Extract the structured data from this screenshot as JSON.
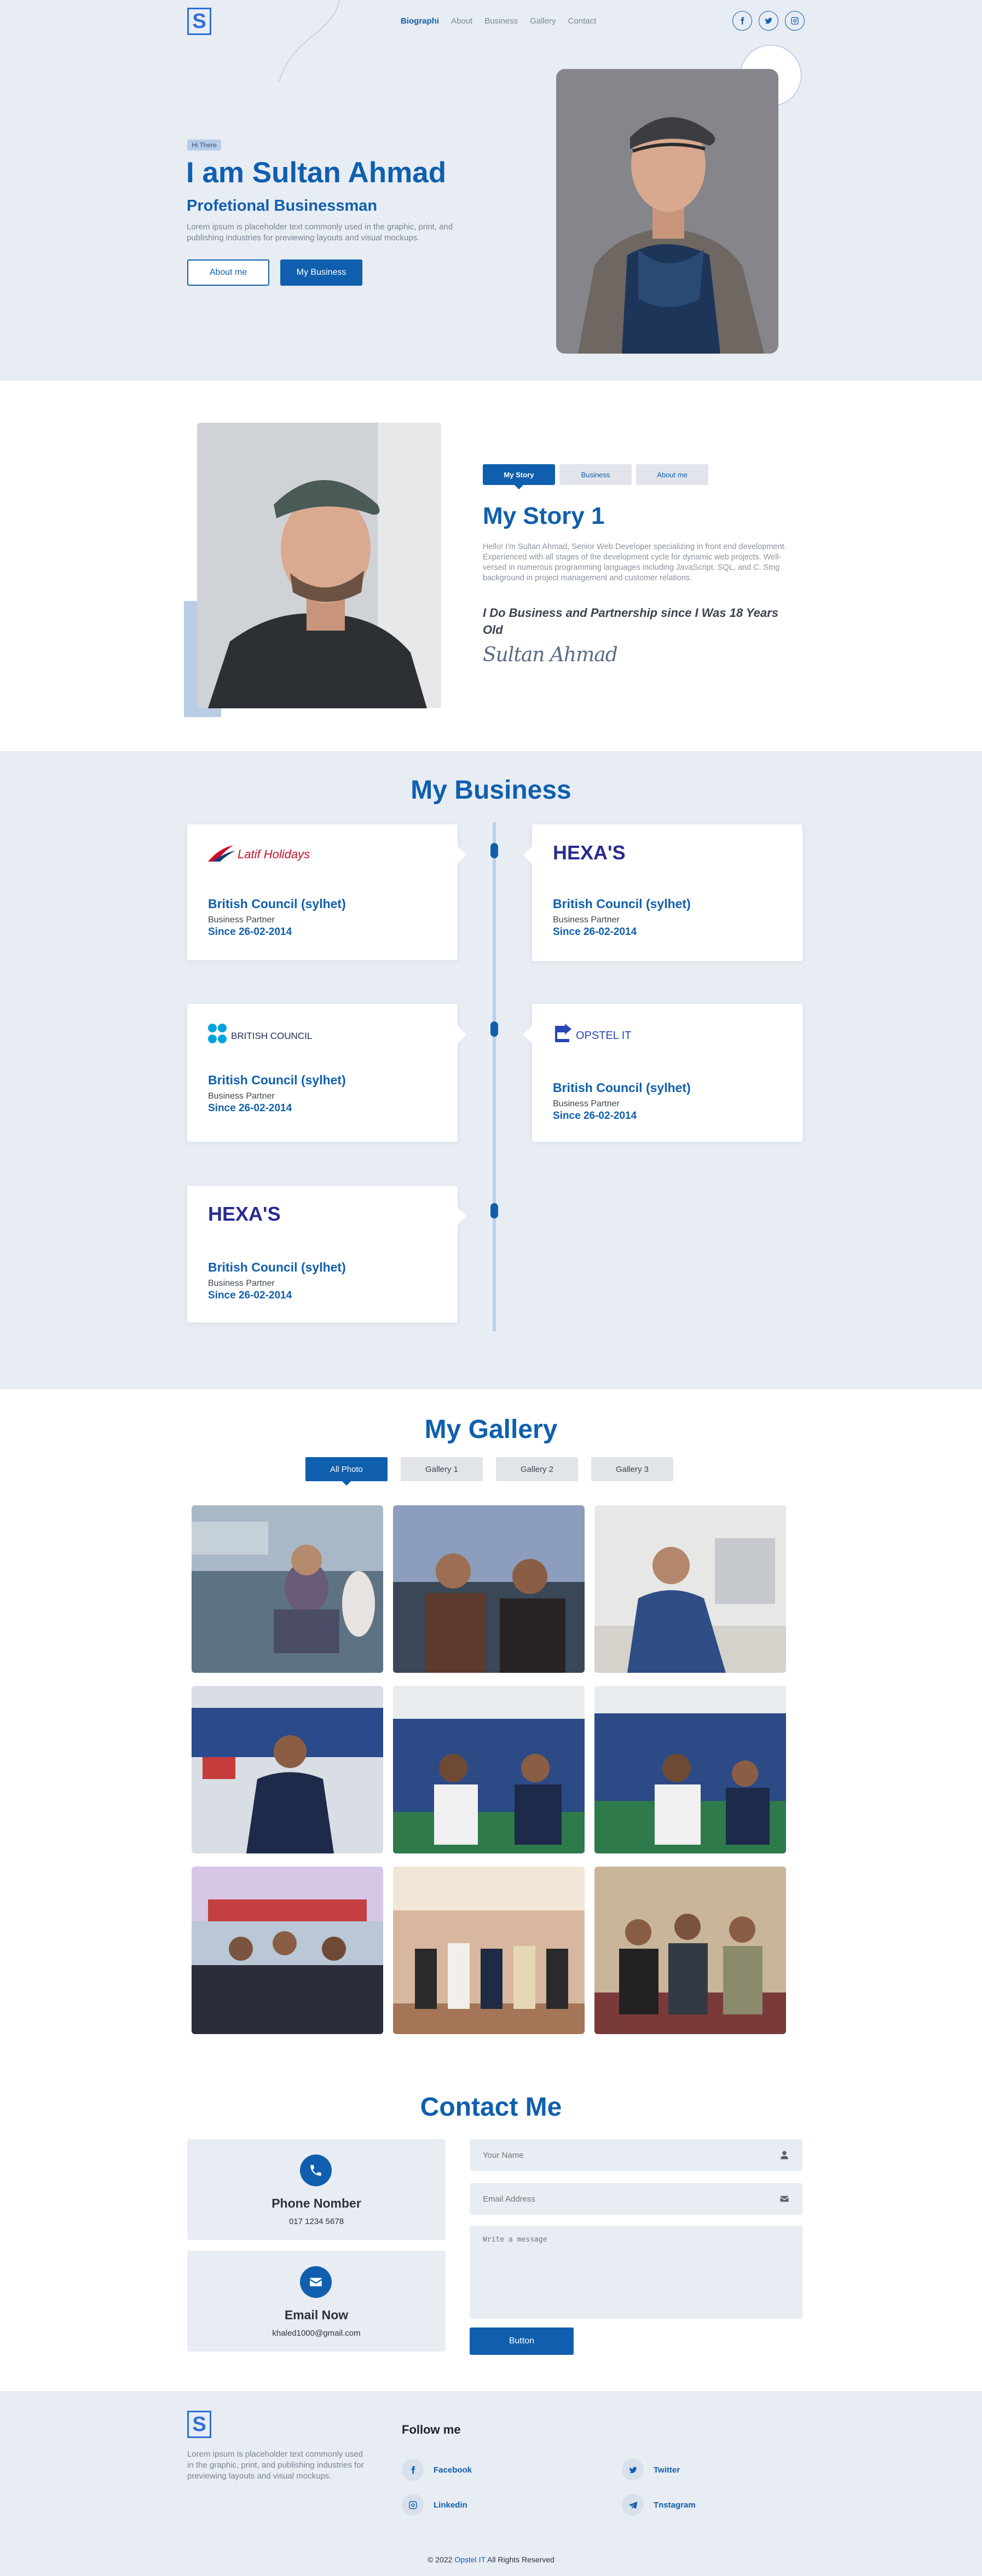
{
  "brand": {
    "logo_letter": "S"
  },
  "nav": {
    "items": [
      {
        "label": "Biographi",
        "active": true
      },
      {
        "label": "About",
        "active": false
      },
      {
        "label": "Business",
        "active": false
      },
      {
        "label": "Gallery",
        "active": false
      },
      {
        "label": "Contact",
        "active": false
      }
    ],
    "social": [
      "facebook-icon",
      "twitter-icon",
      "instagram-icon"
    ]
  },
  "hero": {
    "badge": "Hi There",
    "title": "I am Sultan Ahmad",
    "subtitle": "Profetional Businessman",
    "description": "Lorem ipsum is placeholder text commonly used in the graphic, print, and publishing industries for previewing layouts and visual mockups.",
    "btn_about": "About me",
    "btn_business": "My Business"
  },
  "story": {
    "tabs": [
      {
        "label": "My Story",
        "active": true
      },
      {
        "label": "Business",
        "active": false
      },
      {
        "label": "About me",
        "active": false
      }
    ],
    "title": "My Story 1",
    "text": "Hello! I'm Sultan Ahmad, Senior Web Developer specializing in front end development. Experienced with all stages of the development cycle for dynamic web projects. Well-versed in numerous programming languages including JavaScript, SQL, and C. Stng background in project management and customer relations.",
    "quote": "I Do Business and Partnership since I Was 18 Years Old",
    "signature": "Sultan Ahmad"
  },
  "business": {
    "title": "My Business",
    "cards": [
      {
        "logo": "Latif Holidays",
        "logo_key": "latif",
        "name": "British Council (sylhet)",
        "role": "Business Partner",
        "since": "Since 26-02-2014"
      },
      {
        "logo": "HEXA'S",
        "logo_key": "hexas",
        "name": "British Council (sylhet)",
        "role": "Business Partner",
        "since": "Since 26-02-2014"
      },
      {
        "logo": "BRITISH COUNCIL",
        "logo_key": "british",
        "name": "British Council (sylhet)",
        "role": "Business Partner",
        "since": "Since 26-02-2014"
      },
      {
        "logo": "OPSTEL IT",
        "logo_key": "opstel",
        "name": "British Council (sylhet)",
        "role": "Business Partner",
        "since": "Since 26-02-2014"
      },
      {
        "logo": "HEXA'S",
        "logo_key": "hexas",
        "name": "British Council (sylhet)",
        "role": "Business Partner",
        "since": "Since 26-02-2014"
      }
    ]
  },
  "gallery": {
    "title": "My Gallery",
    "tabs": [
      {
        "label": "All Photo",
        "active": true
      },
      {
        "label": "Gallery 1",
        "active": false
      },
      {
        "label": "Gallery 2",
        "active": false
      },
      {
        "label": "Gallery 3",
        "active": false
      }
    ],
    "photo_count": 9
  },
  "contact": {
    "title": "Contact Me",
    "phone_title": "Phone Nomber",
    "phone": "017 1234 5678",
    "email_title": "Email Now",
    "email": "khaled1000@gmail.com",
    "name_placeholder": "Your Name",
    "email_placeholder": "Email Address",
    "message_placeholder": "Write a message",
    "button": "Button"
  },
  "footer": {
    "description": "Lorem ipsum is placeholder text commonly used in the graphic, print, and publishing industries for previewing layouts and visual mockups.",
    "follow_title": "Follow me",
    "links": [
      {
        "label": "Facebook",
        "icon": "facebook-icon"
      },
      {
        "label": "Twitter",
        "icon": "twitter-icon"
      },
      {
        "label": "Linkedin",
        "icon": "instagram-icon"
      },
      {
        "label": "Tnstagram",
        "icon": "telegram-icon"
      }
    ],
    "copyright_prefix": "© 2022",
    "copyright_brand": "Opstel IT",
    "copyright_suffix": "All Rights Reserved"
  },
  "colors": {
    "primary": "#0f5fae",
    "panel": "#e8ecf3",
    "accent_light": "#b9cce6"
  }
}
